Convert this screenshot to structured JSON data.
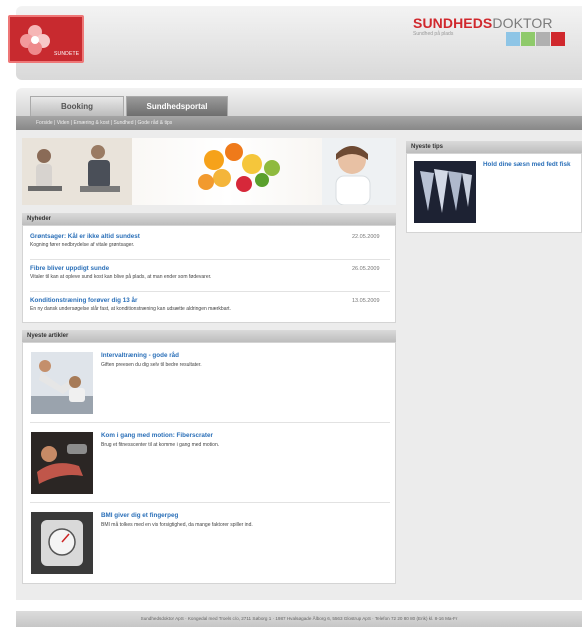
{
  "brand": {
    "logo_text": "SUNDETE",
    "name_part1": "SUNDHEDS",
    "name_part2": "DOKTOR",
    "tagline": "Sundhed på plads",
    "swatch_colors": [
      "#8ec5e6",
      "#8fca6b",
      "#b0b0b0",
      "#d0282d"
    ]
  },
  "tabs": [
    {
      "label": "Booking"
    },
    {
      "label": "Sundhedsportal"
    }
  ],
  "breadcrumbs": "Forside  |  Viden  |  Ernæring & kost  |  Sundhed  |  Gode råd & tips",
  "news": {
    "heading": "Nyheder",
    "items": [
      {
        "title": "Grøntsager: Kål er ikke altid sundest",
        "date": "22.05.2009",
        "text": "Kogning fører nedbrydelse af vitale grøntsager."
      },
      {
        "title": "Fibre bliver uppdigt sunde",
        "date": "26.05.2009",
        "text": "Vitaler til kan at opleve sund kost kan blive på plads, at man ender som fødevarer."
      },
      {
        "title": "Konditionstræning forøver dig 13 år",
        "date": "13.05.2009",
        "text": "En ny dansk undersøgelse slår fast, at konditionstræning kan udsætte aldringen mærkbart."
      }
    ]
  },
  "articles": {
    "heading": "Nyeste artikler",
    "items": [
      {
        "title": "Intervaltræning - gode råd",
        "text": "Giften preesen du dig selv til bedre resultater."
      },
      {
        "title": "Kom i gang med motion: Fiberscrater",
        "text": "Brug et fitnesscenter til at komme i gang med motion."
      },
      {
        "title": "BMI giver dig et fingerpeg",
        "text": "BMI må tolkes med en vis forsigtighed, da mange faktorer spiller ind."
      }
    ]
  },
  "tips": {
    "heading": "Nyeste tips",
    "items": [
      {
        "title": "Hold dine sæsn med fedt fisk"
      }
    ]
  },
  "footer": "Sundhedsdoktor ApS · Kongedal med Troels c/o, 2711 Søborg 1 · 1987 Hvalsøgade Ålborg 6, 5563 Glostrup ApS · Telefon 72 20 80 80 (Erik) kl. 8-16 Ma-Fr"
}
